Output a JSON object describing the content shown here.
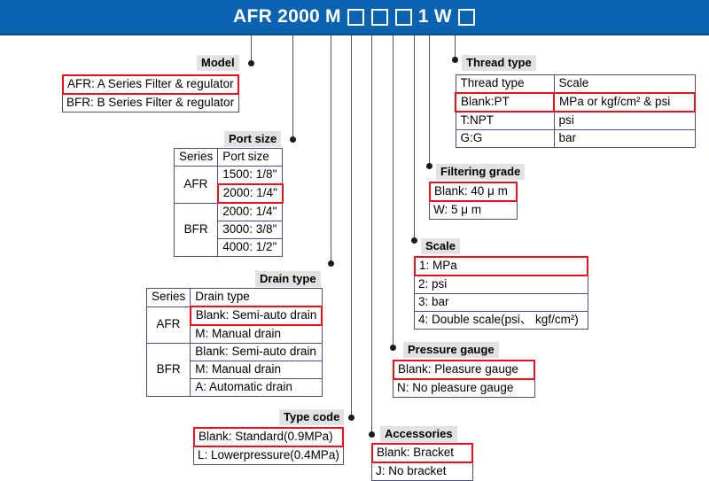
{
  "header": {
    "code_parts": [
      "AFR",
      "2000",
      "M",
      "□",
      "□",
      "□",
      "1",
      "W",
      "□"
    ],
    "code_text": "AFR 2000 M □ □ □ 1 W □",
    "background_color": "#0b62b0"
  },
  "colors": {
    "header_blue": "#0b62b0",
    "highlight_red": "#e8121a",
    "table_border": "#4a4f8c",
    "caption_background": "#e2e2e2",
    "leader_line": "#555555"
  },
  "sections": {
    "model": {
      "caption": "Model",
      "options": [
        {
          "text": "AFR: A Series Filter & regulator",
          "highlighted": true
        },
        {
          "text": "BFR: B Series Filter & regulator",
          "highlighted": false
        }
      ]
    },
    "port_size": {
      "caption": "Port size",
      "headers": [
        "Series",
        "Port size"
      ],
      "groups": [
        {
          "series": "AFR",
          "values": [
            {
              "text": "1500: 1/8\"",
              "highlighted": false
            },
            {
              "text": "2000: 1/4\"",
              "highlighted": true
            }
          ]
        },
        {
          "series": "BFR",
          "values": [
            {
              "text": "2000: 1/4\"",
              "highlighted": false
            },
            {
              "text": "3000: 3/8\"",
              "highlighted": false
            },
            {
              "text": "4000: 1/2\"",
              "highlighted": false
            }
          ]
        }
      ]
    },
    "drain_type": {
      "caption": "Drain type",
      "headers": [
        "Series",
        "Drain type"
      ],
      "groups": [
        {
          "series": "AFR",
          "values": [
            {
              "text": "Blank: Semi-auto drain",
              "highlighted": true
            },
            {
              "text": "M: Manual drain",
              "highlighted": false
            }
          ]
        },
        {
          "series": "BFR",
          "values": [
            {
              "text": "Blank: Semi-auto drain",
              "highlighted": false
            },
            {
              "text": "M: Manual drain",
              "highlighted": false
            },
            {
              "text": "A: Automatic drain",
              "highlighted": false
            }
          ]
        }
      ]
    },
    "type_code": {
      "caption": "Type code",
      "options": [
        {
          "text": "Blank: Standard(0.9MPa)",
          "highlighted": true
        },
        {
          "text": "L: Lowerpressure(0.4MPa)",
          "highlighted": false
        }
      ]
    },
    "thread_type": {
      "caption": "Thread type",
      "headers": [
        "Thread type",
        "Scale"
      ],
      "rows": [
        {
          "thread": "Blank:PT",
          "scale": "MPa or  kgf/cm² & psi",
          "highlighted": true
        },
        {
          "thread": "T:NPT",
          "scale": "psi",
          "highlighted": false
        },
        {
          "thread": "G:G",
          "scale": "bar",
          "highlighted": false
        }
      ]
    },
    "filtering_grade": {
      "caption": "Filtering grade",
      "options": [
        {
          "text": "Blank: 40 μ m",
          "highlighted": true
        },
        {
          "text": "W: 5 μ m",
          "highlighted": false
        }
      ]
    },
    "scale": {
      "caption": "Scale",
      "options": [
        {
          "text": "1: MPa",
          "highlighted": true
        },
        {
          "text": "2: psi",
          "highlighted": false
        },
        {
          "text": "3: bar",
          "highlighted": false
        },
        {
          "text": "4: Double scale(psi、 kgf/cm²)",
          "highlighted": false
        }
      ]
    },
    "pressure_gauge": {
      "caption": "Pressure gauge",
      "options": [
        {
          "text": "Blank: Pleasure gauge",
          "highlighted": true
        },
        {
          "text": "N: No pleasure gauge",
          "highlighted": false
        }
      ]
    },
    "accessories": {
      "caption": "Accessories",
      "options": [
        {
          "text": "Blank: Bracket",
          "highlighted": true
        },
        {
          "text": "J: No bracket",
          "highlighted": false
        }
      ]
    }
  }
}
